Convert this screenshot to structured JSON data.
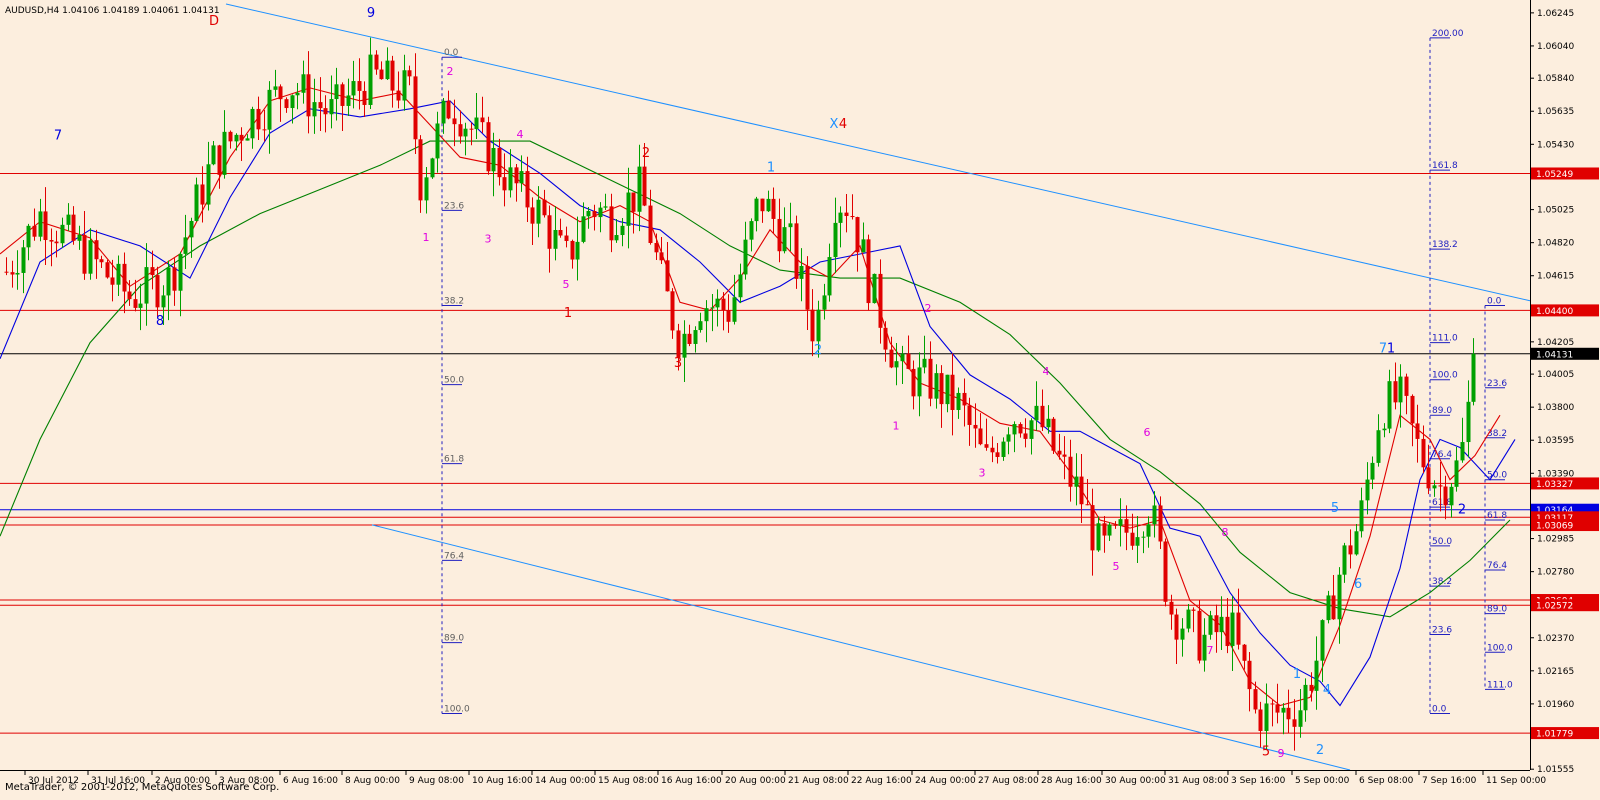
{
  "window": {
    "header": "AUDUSD,H4  1.04106 1.04189 1.04061 1.04131",
    "footer": "MetaTrader, © 2001-2012, MetaQuotes Software Corp."
  },
  "colors": {
    "background": "#FCEEDE",
    "bull": "#00A000",
    "bear": "#E00000",
    "ma_fast": "#E00000",
    "ma_mid": "#0000E0",
    "ma_slow": "#008000",
    "channel": "#1E90FF",
    "support_resistance": "#E00000",
    "fib": "#2020C0"
  },
  "chart_data": {
    "type": "candlestick",
    "symbol": "AUDUSD",
    "timeframe": "H4",
    "last_ohlc": {
      "open": 1.04106,
      "high": 1.04189,
      "low": 1.04061,
      "close": 1.04131
    },
    "ylim": [
      1.0155,
      1.063
    ],
    "y_ticks": [
      "1.06245",
      "1.06040",
      "1.05840",
      "1.05635",
      "1.05430",
      "1.05025",
      "1.04820",
      "1.04615",
      "1.04205",
      "1.04005",
      "1.03800",
      "1.03595",
      "1.03390",
      "1.02985",
      "1.02780",
      "1.02575",
      "1.02370",
      "1.02165",
      "1.01960",
      "1.01555"
    ],
    "x_ticks": [
      "30 Jul 2012",
      "31 Jul 16:00",
      "2 Aug 00:00",
      "3 Aug 08:00",
      "6 Aug 16:00",
      "8 Aug 00:00",
      "9 Aug 08:00",
      "10 Aug 16:00",
      "14 Aug 00:00",
      "15 Aug 08:00",
      "16 Aug 16:00",
      "20 Aug 00:00",
      "21 Aug 08:00",
      "22 Aug 16:00",
      "24 Aug 00:00",
      "27 Aug 08:00",
      "28 Aug 16:00",
      "30 Aug 00:00",
      "31 Aug 08:00",
      "3 Sep 16:00",
      "5 Sep 00:00",
      "6 Sep 08:00",
      "7 Sep 16:00",
      "11 Sep 00:00"
    ],
    "x_tick_positions": [
      25,
      88,
      152,
      216,
      280,
      342,
      406,
      469,
      532,
      595,
      658,
      722,
      785,
      848,
      912,
      975,
      1038,
      1102,
      1165,
      1228,
      1292,
      1356,
      1419,
      1483
    ],
    "price_path": [
      [
        6,
        1.0464
      ],
      [
        40,
        1.05
      ],
      [
        80,
        1.0478
      ],
      [
        130,
        1.0448
      ],
      [
        170,
        1.046
      ],
      [
        210,
        1.053
      ],
      [
        250,
        1.056
      ],
      [
        290,
        1.058
      ],
      [
        330,
        1.0562
      ],
      [
        372,
        1.0585
      ],
      [
        410,
        1.0575
      ],
      [
        420,
        1.052
      ],
      [
        450,
        1.057
      ],
      [
        480,
        1.0545
      ],
      [
        510,
        1.052
      ],
      [
        540,
        1.05
      ],
      [
        565,
        1.047
      ],
      [
        590,
        1.0505
      ],
      [
        610,
        1.0498
      ],
      [
        640,
        1.0515
      ],
      [
        660,
        1.046
      ],
      [
        680,
        1.042
      ],
      [
        700,
        1.0445
      ],
      [
        730,
        1.044
      ],
      [
        760,
        1.051
      ],
      [
        790,
        1.048
      ],
      [
        815,
        1.0425
      ],
      [
        835,
        1.051
      ],
      [
        850,
        1.0505
      ],
      [
        870,
        1.0455
      ],
      [
        900,
        1.04
      ],
      [
        930,
        1.0395
      ],
      [
        960,
        1.038
      ],
      [
        985,
        1.0345
      ],
      [
        1010,
        1.0375
      ],
      [
        1040,
        1.037
      ],
      [
        1060,
        1.0345
      ],
      [
        1080,
        1.0325
      ],
      [
        1100,
        1.029
      ],
      [
        1130,
        1.0305
      ],
      [
        1150,
        1.032
      ],
      [
        1170,
        1.0255
      ],
      [
        1200,
        1.0235
      ],
      [
        1230,
        1.0245
      ],
      [
        1255,
        1.019
      ],
      [
        1275,
        1.019
      ],
      [
        1300,
        1.0195
      ],
      [
        1320,
        1.023
      ],
      [
        1340,
        1.028
      ],
      [
        1360,
        1.031
      ],
      [
        1380,
        1.038
      ],
      [
        1400,
        1.0385
      ],
      [
        1420,
        1.035
      ],
      [
        1440,
        1.033
      ],
      [
        1460,
        1.0345
      ],
      [
        1475,
        1.0413
      ]
    ],
    "ma_fast_path": [
      [
        0,
        1.0475
      ],
      [
        40,
        1.0495
      ],
      [
        90,
        1.0485
      ],
      [
        130,
        1.0455
      ],
      [
        180,
        1.0475
      ],
      [
        230,
        1.0535
      ],
      [
        270,
        1.057
      ],
      [
        310,
        1.0578
      ],
      [
        360,
        1.057
      ],
      [
        400,
        1.0575
      ],
      [
        430,
        1.0555
      ],
      [
        460,
        1.0535
      ],
      [
        500,
        1.053
      ],
      [
        540,
        1.051
      ],
      [
        580,
        1.0495
      ],
      [
        620,
        1.0505
      ],
      [
        650,
        1.0495
      ],
      [
        680,
        1.0445
      ],
      [
        710,
        1.044
      ],
      [
        740,
        1.046
      ],
      [
        770,
        1.049
      ],
      [
        800,
        1.047
      ],
      [
        830,
        1.046
      ],
      [
        860,
        1.048
      ],
      [
        890,
        1.042
      ],
      [
        920,
        1.0395
      ],
      [
        960,
        1.0385
      ],
      [
        1000,
        1.037
      ],
      [
        1040,
        1.0365
      ],
      [
        1070,
        1.034
      ],
      [
        1100,
        1.031
      ],
      [
        1130,
        1.0305
      ],
      [
        1160,
        1.031
      ],
      [
        1190,
        1.026
      ],
      [
        1220,
        1.0245
      ],
      [
        1250,
        1.021
      ],
      [
        1280,
        1.0195
      ],
      [
        1310,
        1.02
      ],
      [
        1340,
        1.0245
      ],
      [
        1370,
        1.03
      ],
      [
        1400,
        1.0375
      ],
      [
        1430,
        1.036
      ],
      [
        1450,
        1.0335
      ],
      [
        1475,
        1.035
      ],
      [
        1500,
        1.0375
      ]
    ],
    "ma_mid_path": [
      [
        0,
        1.041
      ],
      [
        40,
        1.047
      ],
      [
        90,
        1.049
      ],
      [
        140,
        1.048
      ],
      [
        190,
        1.046
      ],
      [
        230,
        1.051
      ],
      [
        270,
        1.055
      ],
      [
        310,
        1.0565
      ],
      [
        360,
        1.056
      ],
      [
        410,
        1.0565
      ],
      [
        450,
        1.057
      ],
      [
        490,
        1.0545
      ],
      [
        540,
        1.0525
      ],
      [
        580,
        1.0505
      ],
      [
        620,
        1.0495
      ],
      [
        660,
        1.049
      ],
      [
        700,
        1.047
      ],
      [
        740,
        1.0445
      ],
      [
        780,
        1.0455
      ],
      [
        820,
        1.047
      ],
      [
        860,
        1.0475
      ],
      [
        900,
        1.048
      ],
      [
        930,
        1.043
      ],
      [
        970,
        1.04
      ],
      [
        1010,
        1.0385
      ],
      [
        1050,
        1.0365
      ],
      [
        1080,
        1.0365
      ],
      [
        1110,
        1.0355
      ],
      [
        1140,
        1.0345
      ],
      [
        1170,
        1.0305
      ],
      [
        1200,
        1.03
      ],
      [
        1230,
        1.0265
      ],
      [
        1260,
        1.024
      ],
      [
        1290,
        1.022
      ],
      [
        1320,
        1.021
      ],
      [
        1340,
        1.0195
      ],
      [
        1370,
        1.0225
      ],
      [
        1400,
        1.028
      ],
      [
        1420,
        1.0335
      ],
      [
        1440,
        1.036
      ],
      [
        1460,
        1.0355
      ],
      [
        1490,
        1.0335
      ],
      [
        1515,
        1.036
      ]
    ],
    "ma_slow_path": [
      [
        0,
        1.03
      ],
      [
        40,
        1.036
      ],
      [
        90,
        1.042
      ],
      [
        140,
        1.0455
      ],
      [
        200,
        1.048
      ],
      [
        260,
        1.05
      ],
      [
        320,
        1.0515
      ],
      [
        380,
        1.053
      ],
      [
        430,
        1.0545
      ],
      [
        480,
        1.0545
      ],
      [
        530,
        1.0545
      ],
      [
        580,
        1.053
      ],
      [
        630,
        1.0515
      ],
      [
        680,
        1.05
      ],
      [
        730,
        1.048
      ],
      [
        780,
        1.0465
      ],
      [
        840,
        1.046
      ],
      [
        900,
        1.046
      ],
      [
        960,
        1.0445
      ],
      [
        1010,
        1.0425
      ],
      [
        1060,
        1.0395
      ],
      [
        1110,
        1.036
      ],
      [
        1160,
        1.034
      ],
      [
        1200,
        1.032
      ],
      [
        1240,
        1.029
      ],
      [
        1290,
        1.0265
      ],
      [
        1340,
        1.0255
      ],
      [
        1390,
        1.025
      ],
      [
        1430,
        1.0265
      ],
      [
        1470,
        1.0285
      ],
      [
        1510,
        1.031
      ]
    ],
    "horizontal_lines": [
      {
        "value": 1.05249,
        "label": "1.05249",
        "color": "#E00000"
      },
      {
        "value": 1.044,
        "label": "1.04400",
        "color": "#E00000"
      },
      {
        "value": 1.04131,
        "label": "1.04131",
        "color": "#000000"
      },
      {
        "value": 1.03327,
        "label": "1.03327",
        "color": "#E00000"
      },
      {
        "value": 1.03164,
        "label": "1.03164",
        "color": "#0000E0"
      },
      {
        "value": 1.03117,
        "label": "1.03117",
        "color": "#E00000"
      },
      {
        "value": 1.03069,
        "label": "1.03069",
        "color": "#E00000"
      },
      {
        "value": 1.02604,
        "label": "1.02604",
        "color": "#E00000"
      },
      {
        "value": 1.02572,
        "label": "1.02572",
        "color": "#E00000"
      },
      {
        "value": 1.01779,
        "label": "1.01779",
        "color": "#E00000"
      }
    ],
    "channel_lines": [
      {
        "x1": 226,
        "y1": 1.063,
        "x2": 1530,
        "y2": 1.0446
      },
      {
        "x1": 372,
        "y1": 1.0307,
        "x2": 1350,
        "y2": 1.0155
      }
    ],
    "fib_sets": [
      {
        "x": 442,
        "levels": [
          [
            "0.0",
            1.0597
          ],
          [
            "23.6",
            1.0502
          ],
          [
            "38.2",
            1.0443
          ],
          [
            "50.0",
            1.0394
          ],
          [
            "61.8",
            1.0345
          ],
          [
            "76.4",
            1.0285
          ],
          [
            "89.0",
            1.0234
          ],
          [
            "100.0",
            1.019
          ]
        ]
      },
      {
        "x": 1430,
        "levels": [
          [
            "200.00",
            1.0609
          ],
          [
            "161.8",
            1.0527
          ],
          [
            "138.2",
            1.0478
          ],
          [
            "111.0",
            1.042
          ],
          [
            "100.0",
            1.0397
          ],
          [
            "89.0",
            1.0375
          ],
          [
            "76.4",
            1.0348
          ],
          [
            "61.8",
            1.0318
          ],
          [
            "50.0",
            1.0294
          ],
          [
            "38.2",
            1.0269
          ],
          [
            "23.6",
            1.0239
          ],
          [
            "0.0",
            1.019
          ]
        ]
      },
      {
        "x": 1485,
        "levels": [
          [
            "0.0",
            1.0443
          ],
          [
            "23.6",
            1.0392
          ],
          [
            "38.2",
            1.0361
          ],
          [
            "50.0",
            1.0335
          ],
          [
            "61.8",
            1.031
          ],
          [
            "76.4",
            1.0279
          ],
          [
            "89.0",
            1.0252
          ],
          [
            "100.0",
            1.0228
          ],
          [
            "111.0",
            1.0205
          ]
        ]
      }
    ],
    "wave_labels": [
      {
        "text": "D",
        "x": 214,
        "y": 1.0617,
        "color": "#E00000"
      },
      {
        "text": "9",
        "x": 371,
        "y": 1.0622,
        "color": "#0000E0"
      },
      {
        "text": "7",
        "x": 58,
        "y": 1.0546,
        "color": "#0000E0"
      },
      {
        "text": "8",
        "x": 160,
        "y": 1.0431,
        "color": "#0000E0"
      },
      {
        "text": "2",
        "x": 450,
        "y": 1.0586,
        "color": "#E000E0"
      },
      {
        "text": "1",
        "x": 426,
        "y": 1.0483,
        "color": "#E000E0"
      },
      {
        "text": "3",
        "x": 488,
        "y": 1.0482,
        "color": "#E000E0"
      },
      {
        "text": "4",
        "x": 520,
        "y": 1.0547,
        "color": "#E000E0"
      },
      {
        "text": "5",
        "x": 566,
        "y": 1.0454,
        "color": "#E000E0"
      },
      {
        "text": "2",
        "x": 646,
        "y": 1.0535,
        "color": "#E00000"
      },
      {
        "text": "1",
        "x": 568,
        "y": 1.0436,
        "color": "#E00000"
      },
      {
        "text": "3",
        "x": 678,
        "y": 1.0405,
        "color": "#E00000"
      },
      {
        "text": "1",
        "x": 771,
        "y": 1.0526,
        "color": "#1E90FF"
      },
      {
        "text": "X",
        "x": 834,
        "y": 1.0553,
        "color": "#1E90FF"
      },
      {
        "text": "4",
        "x": 843,
        "y": 1.0553,
        "color": "#E00000"
      },
      {
        "text": "2",
        "x": 818,
        "y": 1.0413,
        "color": "#1E90FF"
      },
      {
        "text": "2",
        "x": 928,
        "y": 1.0439,
        "color": "#E000E0"
      },
      {
        "text": "1",
        "x": 896,
        "y": 1.0366,
        "color": "#E000E0"
      },
      {
        "text": "3",
        "x": 982,
        "y": 1.0337,
        "color": "#E000E0"
      },
      {
        "text": "4",
        "x": 1046,
        "y": 1.04,
        "color": "#E000E0"
      },
      {
        "text": "5",
        "x": 1116,
        "y": 1.0279,
        "color": "#E000E0"
      },
      {
        "text": "6",
        "x": 1147,
        "y": 1.0362,
        "color": "#E000E0"
      },
      {
        "text": "8",
        "x": 1225,
        "y": 1.03,
        "color": "#E000E0"
      },
      {
        "text": "7",
        "x": 1210,
        "y": 1.0227,
        "color": "#E000E0"
      },
      {
        "text": "5",
        "x": 1335,
        "y": 1.0315,
        "color": "#1E90FF"
      },
      {
        "text": "6",
        "x": 1358,
        "y": 1.0268,
        "color": "#1E90FF"
      },
      {
        "text": "1",
        "x": 1297,
        "y": 1.0212,
        "color": "#1E90FF"
      },
      {
        "text": "4",
        "x": 1327,
        "y": 1.0202,
        "color": "#1E90FF"
      },
      {
        "text": "2",
        "x": 1320,
        "y": 1.0165,
        "color": "#1E90FF"
      },
      {
        "text": "5",
        "x": 1266,
        "y": 1.0164,
        "color": "#E00000"
      },
      {
        "text": "9",
        "x": 1281,
        "y": 1.0163,
        "color": "#E000E0"
      },
      {
        "text": "7",
        "x": 1383,
        "y": 1.0414,
        "color": "#1E90FF"
      },
      {
        "text": "1",
        "x": 1391,
        "y": 1.0414,
        "color": "#0000E0"
      },
      {
        "text": "2",
        "x": 1462,
        "y": 1.0314,
        "color": "#0000E0"
      }
    ]
  }
}
